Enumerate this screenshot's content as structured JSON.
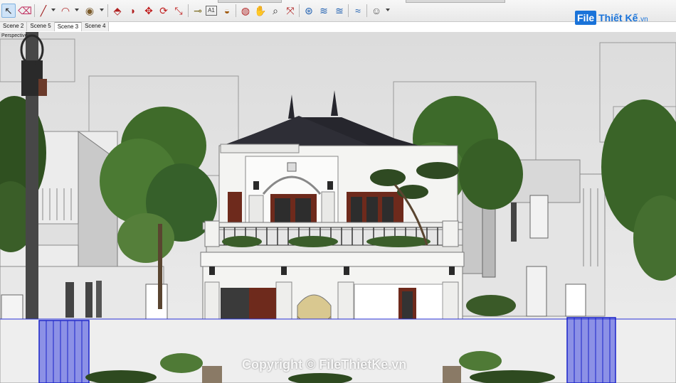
{
  "toolbar": {
    "tools": [
      {
        "name": "select-tool",
        "glyph": "↖"
      },
      {
        "name": "eraser-tool",
        "glyph": "⌫"
      },
      {
        "name": "line-tool",
        "glyph": "╱"
      },
      {
        "name": "arc-tool",
        "glyph": "◠"
      },
      {
        "name": "shape-tool",
        "glyph": "◉"
      },
      {
        "name": "push-pull-tool",
        "glyph": "⬘"
      },
      {
        "name": "follow-me-tool",
        "glyph": "◗"
      },
      {
        "name": "move-tool",
        "glyph": "✥"
      },
      {
        "name": "rotate-tool",
        "glyph": "⟳"
      },
      {
        "name": "scale-tool",
        "glyph": "⤡"
      },
      {
        "name": "tape-measure-tool",
        "glyph": "⊸"
      },
      {
        "name": "text-tool",
        "glyph": "A1"
      },
      {
        "name": "paint-bucket-tool",
        "glyph": "◒"
      },
      {
        "name": "orbit-tool",
        "glyph": "◍"
      },
      {
        "name": "pan-tool",
        "glyph": "✋"
      },
      {
        "name": "zoom-tool",
        "glyph": "⌕"
      },
      {
        "name": "zoom-extents-tool",
        "glyph": "⤧"
      },
      {
        "name": "warehouse-icon",
        "glyph": "⊛"
      },
      {
        "name": "extension-warehouse-icon",
        "glyph": "≋"
      },
      {
        "name": "layout-icon",
        "glyph": "≊"
      },
      {
        "name": "extension-manager-icon",
        "glyph": "≈"
      },
      {
        "name": "account-icon",
        "glyph": "☺"
      }
    ]
  },
  "logo": {
    "box": "File",
    "text": "Thiết Kế",
    "suffix": ".vn"
  },
  "scene_tabs": [
    "Scene 2",
    "Scene 5",
    "Scene 3",
    "Scene 4"
  ],
  "active_scene": "Scene 3",
  "viewport": {
    "camera_label": "Perspective"
  },
  "watermark": "Copyright © FileThietKe.vn",
  "colors": {
    "roof": "#26262d",
    "facade": "#f4f4f2",
    "wood": "#6e2a1c",
    "selection": "#2a32d8",
    "foliage": "#3f6b2a"
  }
}
